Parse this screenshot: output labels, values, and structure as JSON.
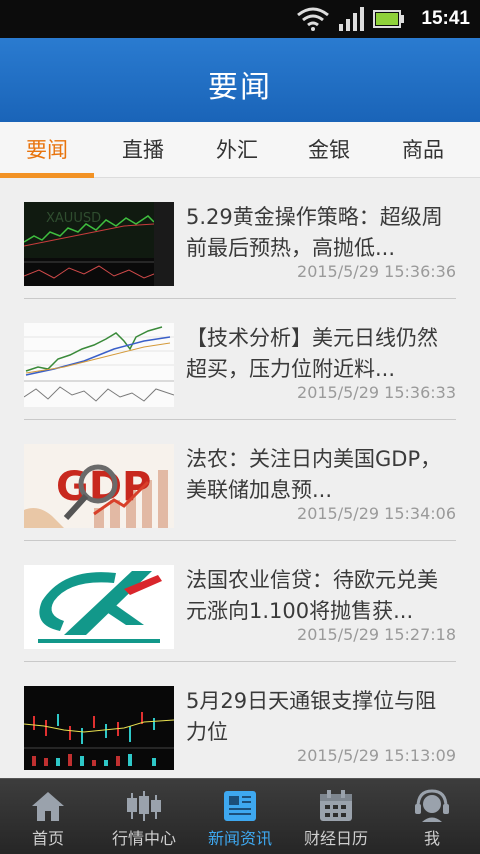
{
  "status_bar": {
    "time": "15:41"
  },
  "header": {
    "title": "要闻"
  },
  "tabs": [
    {
      "label": "要闻",
      "active": true
    },
    {
      "label": "直播",
      "active": false
    },
    {
      "label": "外汇",
      "active": false
    },
    {
      "label": "金银",
      "active": false
    },
    {
      "label": "商品",
      "active": false
    }
  ],
  "news": [
    {
      "headline": "5.29黄金操作策略：超级周前最后预热，高抛低...",
      "time": "2015/5/29 15:36:36",
      "thumb": "chart-dark-icon",
      "thumb_text": "XAUUSD"
    },
    {
      "headline": "【技术分析】美元日线仍然超买，压力位附近料...",
      "time": "2015/5/29 15:36:33",
      "thumb": "chart-light-icon"
    },
    {
      "headline": "法农：关注日内美国GDP，美联储加息预...",
      "time": "2015/5/29 15:34:06",
      "thumb": "gdp-icon",
      "thumb_text": "GDP"
    },
    {
      "headline": "法国农业信贷：待欧元兑美元涨向1.100将抛售获...",
      "time": "2015/5/29 15:27:18",
      "thumb": "credit-agricole-logo"
    },
    {
      "headline": "5月29日天通银支撑位与阻力位",
      "time": "2015/5/29 15:13:09",
      "thumb": "candlestick-chart-icon"
    }
  ],
  "bottom_nav": [
    {
      "label": "首页",
      "icon": "home-icon",
      "active": false
    },
    {
      "label": "行情中心",
      "icon": "candlestick-icon",
      "active": false
    },
    {
      "label": "新闻资讯",
      "icon": "newspaper-icon",
      "active": true
    },
    {
      "label": "财经日历",
      "icon": "calendar-icon",
      "active": false
    },
    {
      "label": "我",
      "icon": "headset-icon",
      "active": false
    }
  ],
  "colors": {
    "header": "#1f6dc2",
    "tab_active": "#e8730c",
    "nav_active": "#3ea8f0"
  }
}
